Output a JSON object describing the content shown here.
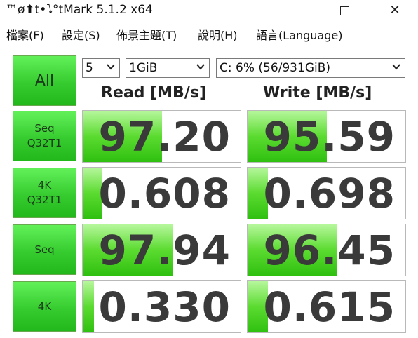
{
  "window": {
    "title": "CrystalDiskMark 5.1.2 x64",
    "title_visible": "™ø⬆t•⭝°tMark 5.1.2 x64"
  },
  "menu": [
    {
      "label": "檔案(F)"
    },
    {
      "label": "設定(S)"
    },
    {
      "label": "佈景主題(T)"
    },
    {
      "label": "說明(H)"
    },
    {
      "label": "語言(Language)"
    }
  ],
  "controls": {
    "all_label": "All",
    "count": "5",
    "size": "1GiB",
    "drive": "C: 6% (56/931GiB)"
  },
  "headers": {
    "read": "Read [MB/s]",
    "write": "Write [MB/s]"
  },
  "tests": [
    {
      "label1": "Seq",
      "label2": "Q32T1",
      "read": "97.20",
      "write": "95.59",
      "read_fill": 0.5,
      "write_fill": 0.5
    },
    {
      "label1": "4K",
      "label2": "Q32T1",
      "read": "0.608",
      "write": "0.698",
      "read_fill": 0.12,
      "write_fill": 0.13
    },
    {
      "label1": "Seq",
      "label2": "",
      "read": "97.94",
      "write": "96.45",
      "read_fill": 0.57,
      "write_fill": 0.57
    },
    {
      "label1": "4K",
      "label2": "",
      "read": "0.330",
      "write": "0.615",
      "read_fill": 0.07,
      "write_fill": 0.13
    }
  ],
  "colors": {
    "button_green": "#36cc30",
    "bar_green": "#5bdb30"
  }
}
